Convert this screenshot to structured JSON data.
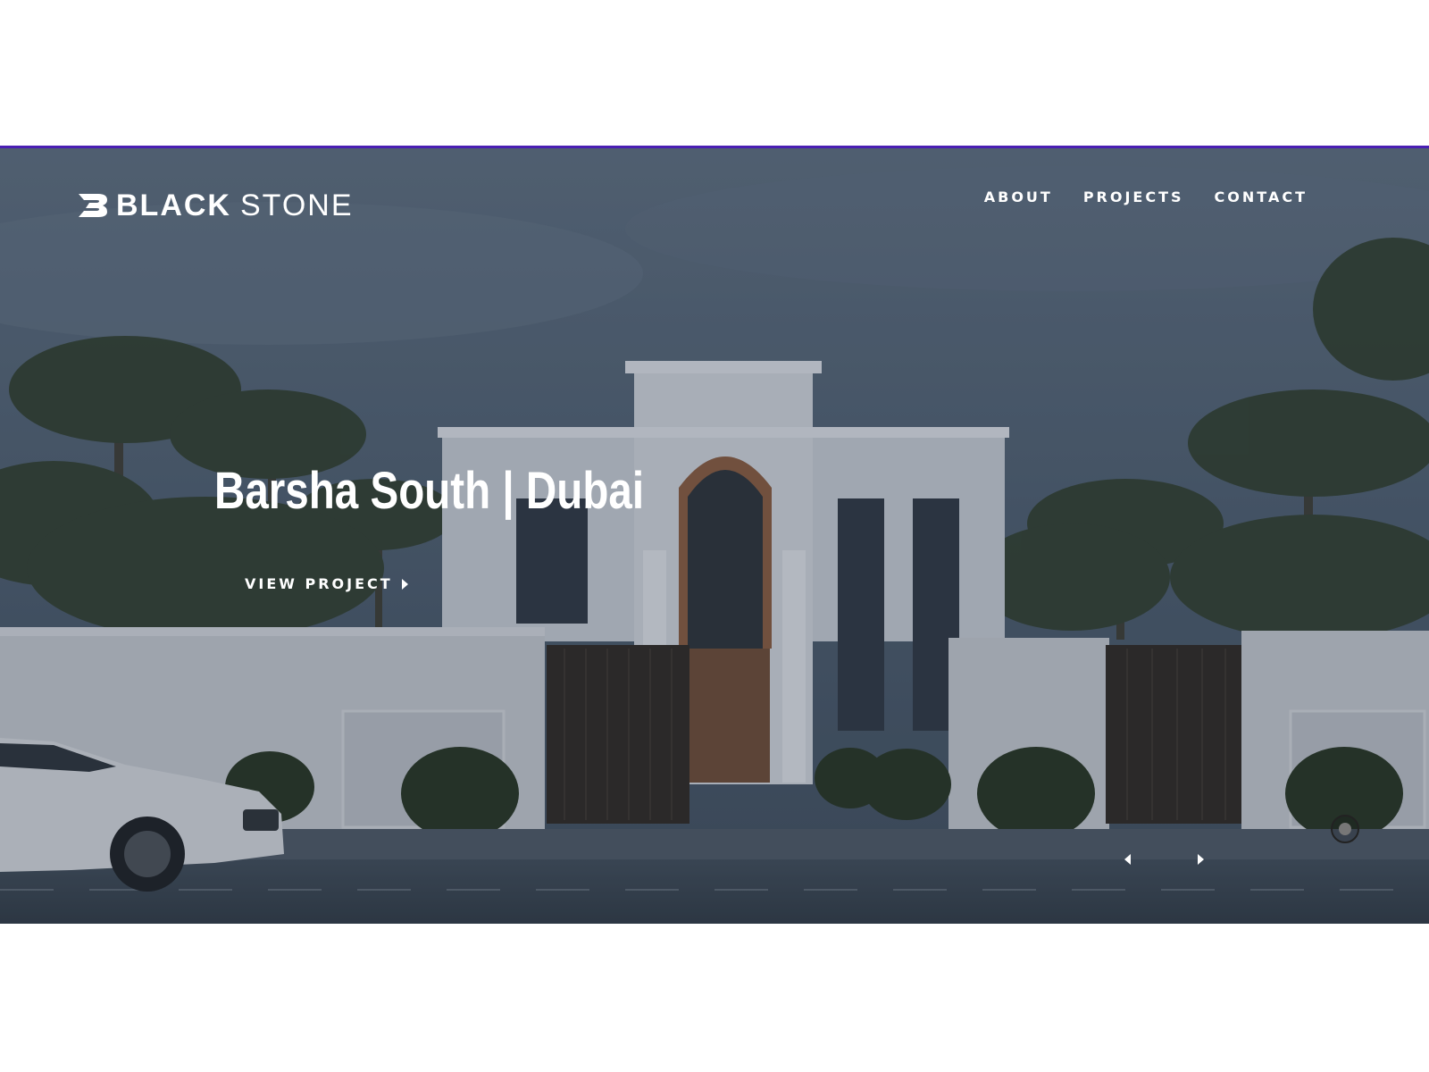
{
  "brand": {
    "word1": "BLACK",
    "word2": "STONE",
    "icon": "blackstone-logo-mark"
  },
  "nav": {
    "items": [
      "ABOUT",
      "PROJECTS",
      "CONTACT"
    ]
  },
  "hero": {
    "title": "Barsha South | Dubai",
    "cta_label": "VIEW PROJECT",
    "cta_icon": "arrow-right-icon",
    "image": "villa-with-palms-and-car"
  },
  "slider": {
    "prev_icon": "arrow-left-icon",
    "next_icon": "arrow-right-icon",
    "scroll_icon": "circle-indicator-icon"
  },
  "colors": {
    "accent_rule": "#4a1fb3",
    "text": "#ffffff",
    "page_bg": "#ffffff"
  }
}
